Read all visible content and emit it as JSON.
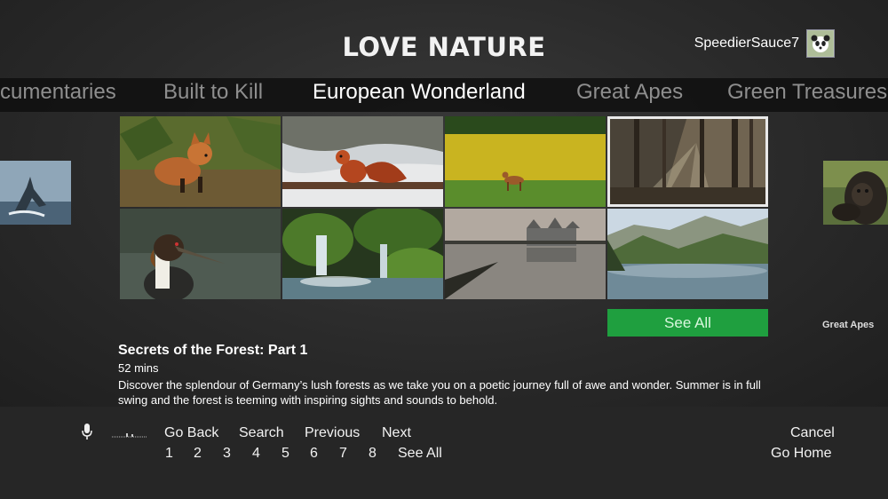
{
  "header": {
    "logo_text": "LOVE NATURE",
    "username": "SpeedierSauce7"
  },
  "tabs": [
    {
      "label": "cumentaries"
    },
    {
      "label": "Built to Kill"
    },
    {
      "label": "European Wonderland"
    },
    {
      "label": "Great Apes"
    },
    {
      "label": "Green Treasures"
    }
  ],
  "tiles": [
    {
      "name": "fox-cub"
    },
    {
      "name": "red-squirrel-in-snow"
    },
    {
      "name": "deer-in-rapeseed-field"
    },
    {
      "name": "sunlit-forest"
    },
    {
      "name": "great-crested-grebe"
    },
    {
      "name": "mossy-waterfall"
    },
    {
      "name": "chateau-lake"
    },
    {
      "name": "mountain-lake"
    }
  ],
  "side_label": "Great Apes",
  "see_all_label": "See All",
  "detail": {
    "title": "Secrets of the Forest: Part 1",
    "duration": "52 mins",
    "description": "Discover the splendour of Germany’s lush forests as we take you on a poetic journey full of awe and wonder. Summer is in full swing and the forest is teeming with inspiring sights and sounds to behold."
  },
  "voice_commands": {
    "go_back": "Go Back",
    "search": "Search",
    "previous": "Previous",
    "next": "Next",
    "numbers": [
      "1",
      "2",
      "3",
      "4",
      "5",
      "6",
      "7",
      "8"
    ],
    "see_all": "See All",
    "cancel": "Cancel",
    "go_home": "Go Home"
  },
  "colors": {
    "accent_green": "#1f9f3f",
    "background": "#2b2b2b"
  }
}
